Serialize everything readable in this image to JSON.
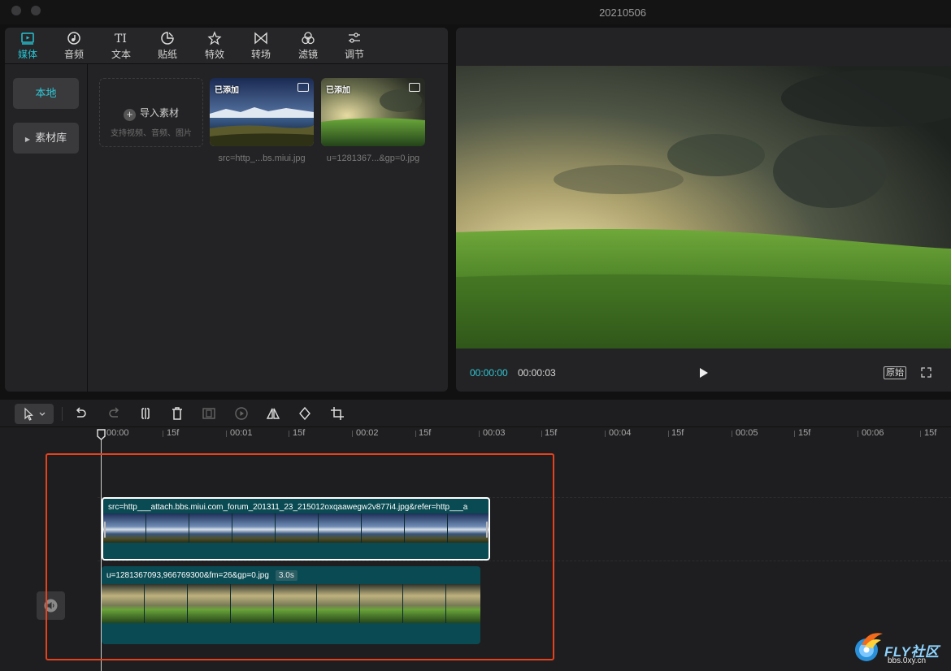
{
  "window": {
    "title": "20210506"
  },
  "media_tabs": [
    {
      "label": "媒体",
      "icon": "media-icon",
      "active": true
    },
    {
      "label": "音频",
      "icon": "audio-icon"
    },
    {
      "label": "文本",
      "icon": "text-icon"
    },
    {
      "label": "贴纸",
      "icon": "sticker-icon"
    },
    {
      "label": "特效",
      "icon": "effects-icon"
    },
    {
      "label": "转场",
      "icon": "transition-icon"
    },
    {
      "label": "滤镜",
      "icon": "filter-icon"
    },
    {
      "label": "调节",
      "icon": "adjust-icon"
    }
  ],
  "sidebar": {
    "local": "本地",
    "library": "素材库"
  },
  "import": {
    "title": "导入素材",
    "subtitle": "支持视频、音频、图片"
  },
  "thumbnails": [
    {
      "badge": "已添加",
      "name": "src=http_...bs.miui.jpg"
    },
    {
      "badge": "已添加",
      "name": "u=1281367...&gp=0.jpg"
    }
  ],
  "preview": {
    "current_time": "00:00:00",
    "total_time": "00:00:03",
    "ratio_label": "原始"
  },
  "ruler_labels": [
    "00:00",
    "15f",
    "00:01",
    "15f",
    "00:02",
    "15f",
    "00:03",
    "15f",
    "00:04",
    "15f",
    "00:05",
    "15f",
    "00:06",
    "15f"
  ],
  "clips": {
    "top": {
      "title": "src=http___attach.bbs.miui.com_forum_201311_23_215012oxqaawegw2v877i4.jpg&refer=http___a"
    },
    "main": {
      "title": "u=1281367093,966769300&fm=26&gp=0.jpg",
      "duration": "3.0s"
    }
  },
  "watermark": {
    "brand": "FLY社区",
    "site": "bbs.0xy.cn"
  },
  "colors": {
    "accent": "#25c2d2",
    "clip_bg": "#0a4a52",
    "highlight": "#e4411c"
  }
}
